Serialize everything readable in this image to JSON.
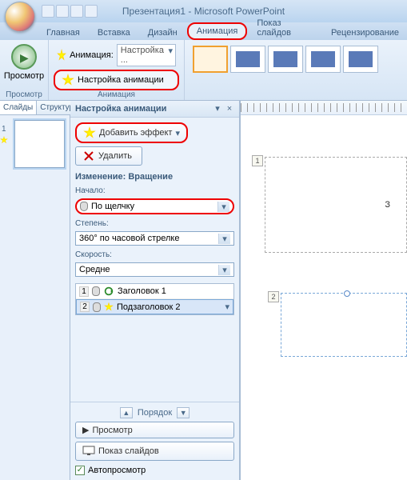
{
  "title": "Презентация1 - Microsoft PowerPoint",
  "tabs": {
    "home": "Главная",
    "insert": "Вставка",
    "design": "Дизайн",
    "animation": "Анимация",
    "slideshow": "Показ слайдов",
    "review": "Рецензирование"
  },
  "ribbon": {
    "preview_btn": "Просмотр",
    "preview_group": "Просмотр",
    "anim_label": "Анимация:",
    "anim_value": "Настройка ...",
    "custom_anim": "Настройка анимации",
    "anim_group": "Анимация"
  },
  "left_tabs": {
    "slides": "Слайды",
    "structure": "Структура"
  },
  "thumb_num": "1",
  "taskpane": {
    "title": "Настройка анимации",
    "add_effect": "Добавить эффект",
    "remove": "Удалить",
    "change_section": "Изменение: Вращение",
    "start_label": "Начало:",
    "start_value": "По щелчку",
    "degree_label": "Степень:",
    "degree_value": "360° по часовой стрелке",
    "speed_label": "Скорость:",
    "speed_value": "Средне",
    "effects": [
      {
        "num": "1",
        "name": "Заголовок 1"
      },
      {
        "num": "2",
        "name": "Подзаголовок 2"
      }
    ],
    "reorder": "Порядок",
    "play": "Просмотр",
    "slideshow": "Показ слайдов",
    "autopreview": "Автопросмотр"
  },
  "slide": {
    "title_text": "З",
    "tag1": "1",
    "tag2": "2"
  }
}
